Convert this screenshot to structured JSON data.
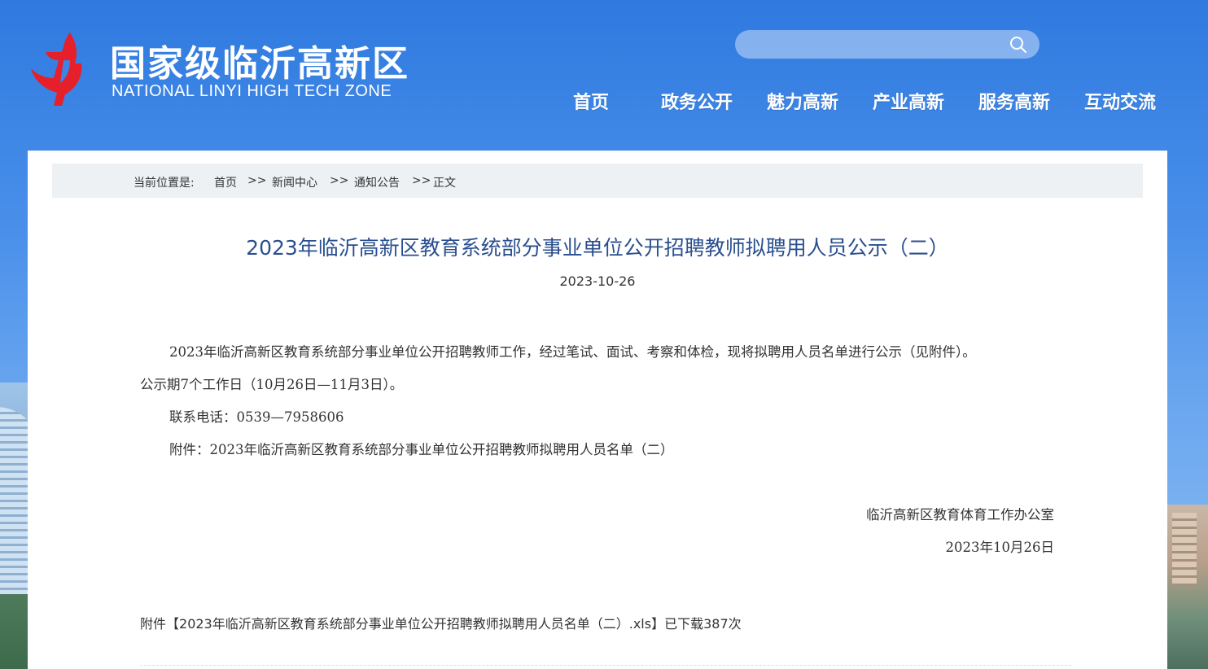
{
  "header": {
    "title": "国家级临沂高新区",
    "subtitle": "NATIONAL LINYI HIGH TECH ZONE",
    "logo_icon": "linyi-hightech-logo",
    "search": {
      "placeholder": "",
      "icon": "search-icon"
    },
    "colors": {
      "header_bg": "#3a85e6",
      "logo_red": "#e5202a"
    }
  },
  "nav": {
    "items": [
      {
        "label": "首页"
      },
      {
        "label": "政务公开"
      },
      {
        "label": "魅力高新"
      },
      {
        "label": "产业高新"
      },
      {
        "label": "服务高新"
      },
      {
        "label": "互动交流"
      }
    ]
  },
  "breadcrumb": {
    "prefix": "当前位置是:",
    "items": [
      "首页",
      "新闻中心",
      "通知公告",
      "正文"
    ],
    "separator": ">>"
  },
  "article": {
    "title": "2023年临沂高新区教育系统部分事业单位公开招聘教师拟聘用人员公示（二）",
    "date": "2023-10-26",
    "paragraph1_line1": "2023年临沂高新区教育系统部分事业单位公开招聘教师工作，经过笔试、面试、考察和体检，现将拟聘用人员名单进行公示（见附件）。",
    "paragraph1_line2": "公示期7个工作日（10月26日—11月3日）。",
    "contact": "联系电话：0539—7958606",
    "attachment_line": "附件：2023年临沂高新区教育系统部分事业单位公开招聘教师拟聘用人员名单（二）",
    "signature": "临沂高新区教育体育工作办公室",
    "signature_date": "2023年10月26日"
  },
  "attachment": {
    "prefix": "附件【",
    "file_name": "2023年临沂高新区教育系统部分事业单位公开招聘教师拟聘用人员名单（二）.xls",
    "suffix": "】已下载387次"
  }
}
